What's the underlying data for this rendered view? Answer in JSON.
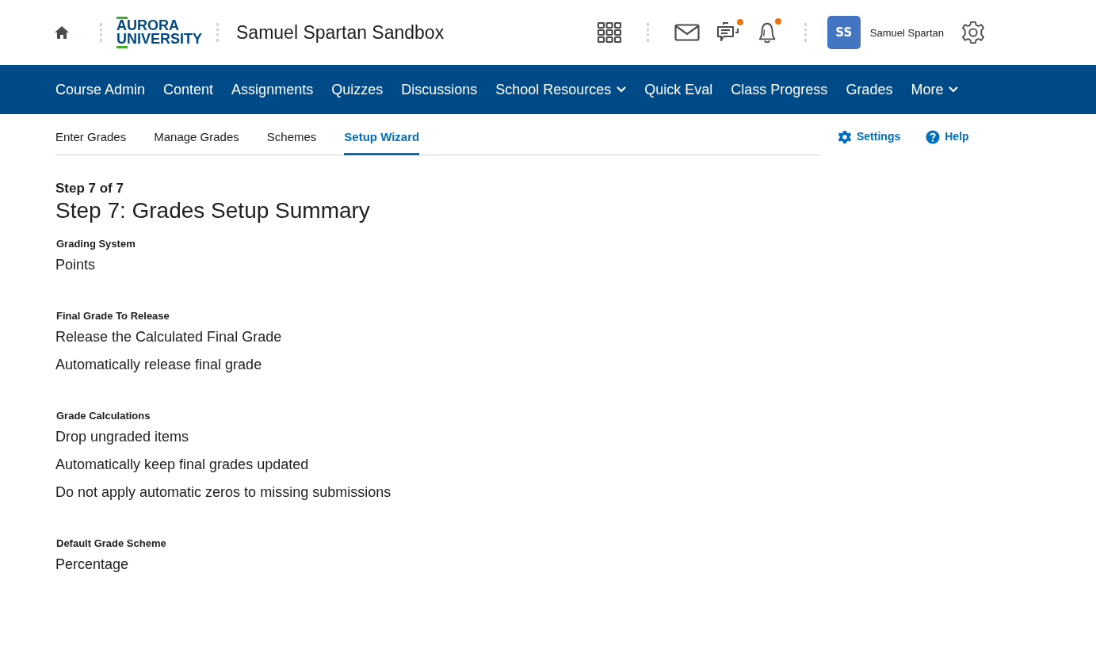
{
  "header": {
    "logo": [
      "AURORA",
      "UNIVERSITY"
    ],
    "course_title": "Samuel Spartan Sandbox",
    "icons": [
      {
        "kind": "grid",
        "badge": false
      },
      {
        "kind": "mail",
        "badge": false
      },
      {
        "kind": "chat",
        "badge": true
      },
      {
        "kind": "bell",
        "badge": true
      }
    ],
    "avatar": "SS",
    "user_name": "Samuel Spartan"
  },
  "nav": [
    {
      "label": "Course Admin",
      "dropdown": false
    },
    {
      "label": "Content",
      "dropdown": false
    },
    {
      "label": "Assignments",
      "dropdown": false
    },
    {
      "label": "Quizzes",
      "dropdown": false
    },
    {
      "label": "Discussions",
      "dropdown": false
    },
    {
      "label": "School Resources",
      "dropdown": true
    },
    {
      "label": "Quick Eval",
      "dropdown": false
    },
    {
      "label": "Class Progress",
      "dropdown": false
    },
    {
      "label": "Grades",
      "dropdown": false
    },
    {
      "label": "More",
      "dropdown": true
    }
  ],
  "tabs": [
    {
      "label": "Enter Grades",
      "selected": false
    },
    {
      "label": "Manage Grades",
      "selected": false
    },
    {
      "label": "Schemes",
      "selected": false
    },
    {
      "label": "Setup Wizard",
      "selected": true
    }
  ],
  "links": [
    {
      "kind": "settings",
      "label": "Settings"
    },
    {
      "kind": "help",
      "label": "Help"
    }
  ],
  "step": "Step 7 of 7",
  "heading": "Step 7: Grades Setup Summary",
  "sections": [
    {
      "label": "Grading System",
      "values": [
        "Points"
      ]
    },
    {
      "label": "Final Grade To Release",
      "values": [
        "Release the Calculated Final Grade",
        "Automatically release final grade"
      ]
    },
    {
      "label": "Grade Calculations",
      "values": [
        "Drop ungraded items",
        "Automatically keep final grades updated",
        "Do not apply automatic zeros to missing submissions"
      ]
    },
    {
      "label": "Default Grade Scheme",
      "values": [
        "Percentage"
      ]
    }
  ]
}
